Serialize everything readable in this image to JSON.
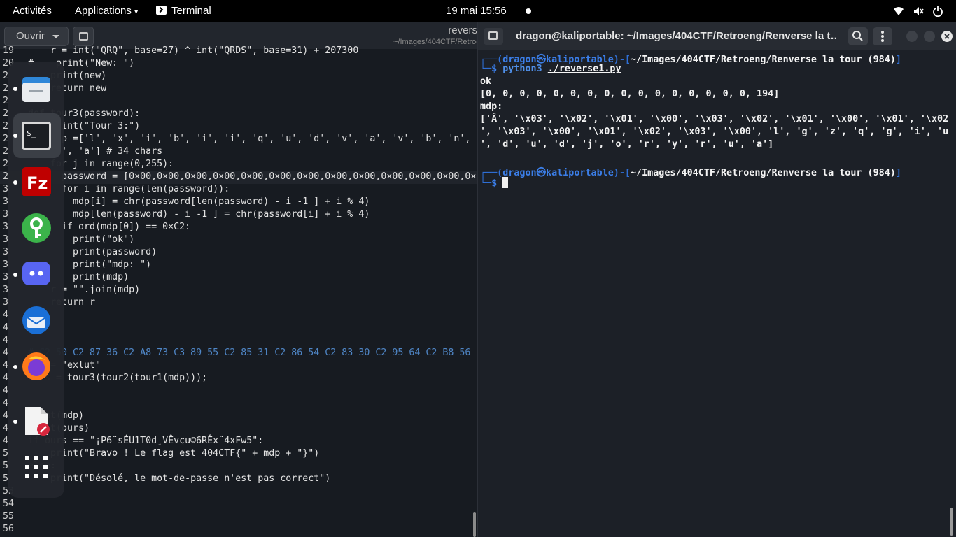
{
  "topbar": {
    "activities": "Activités",
    "applications": "Applications",
    "app_name": "Terminal",
    "clock": "19 mai  15:56"
  },
  "editor": {
    "open_label": "Ouvrir",
    "title": "revers",
    "subtitle": "~/Images/404CTF/Retroe",
    "lines": [
      {
        "n": "19",
        "c": "    r = int(\"QRQ\", base=27) ^ int(\"QRDS\", base=31) + 207300",
        "hl": false
      },
      {
        "n": "20",
        "c": "#    print(\"New: \")",
        "hl": false
      },
      {
        "n": "2",
        "c": "    print(new)",
        "hl": false
      },
      {
        "n": "2",
        "c": "    return new",
        "hl": false
      },
      {
        "n": "2",
        "c": "",
        "hl": false
      },
      {
        "n": "2",
        "c": "def tour3(password):",
        "hl": false
      },
      {
        "n": "2",
        "c": "    print(\"Tour 3:\")",
        "hl": false
      },
      {
        "n": "2",
        "c": "    mdp =['l', 'x', 'i', 'b', 'i', 'i', 'q', 'u', 'd', 'v', 'a', 'v', 'b', 'n', 'l",
        "hl": false
      },
      {
        "n": "2",
        "c": "    'u', 'a'] # 34 chars",
        "hl": false
      },
      {
        "n": "2",
        "c": "    for j in range(0,255):",
        "hl": false
      },
      {
        "n": "2",
        "c": "      password = [0×00,0×00,0×00,0×00,0×00,0×00,0×00,0×00,0×00,0×00,0×00,0×00,0×",
        "hl": true
      },
      {
        "n": "3",
        "c": "      for i in range(len(password)):",
        "hl": false
      },
      {
        "n": "3",
        "c": "        mdp[i] = chr(password[len(password) - i -1 ] + i % 4)",
        "hl": false
      },
      {
        "n": "3",
        "c": "        mdp[len(password) - i -1 ] = chr(password[i] + i % 4)",
        "hl": false
      },
      {
        "n": "3",
        "c": "      if ord(mdp[0]) == 0×C2:",
        "hl": false
      },
      {
        "n": "3",
        "c": "        print(\"ok\")",
        "hl": false
      },
      {
        "n": "3",
        "c": "        print(password)",
        "hl": false
      },
      {
        "n": "3",
        "c": "        print(\"mdp: \")",
        "hl": false
      },
      {
        "n": "3",
        "c": "        print(mdp)",
        "hl": false
      },
      {
        "n": "3",
        "c": "    r = \"\".join(mdp)",
        "hl": false
      },
      {
        "n": "3",
        "c": "    return r",
        "hl": false
      },
      {
        "n": "4",
        "c": "",
        "hl": false
      },
      {
        "n": "4",
        "c": "",
        "hl": false
      },
      {
        "n": "4",
        "c": "",
        "hl": false
      },
      {
        "n": "4",
        "c": "# C2 50 C2 87 36 C2 A8 73 C3 89 55 C2 85 31 C2 86 54 C2 83 30 C2 95 64 C2 B8 56",
        "hl": false,
        "hex": true
      },
      {
        "n": "4",
        "c": "mdp = \"exlut\"",
        "hl": false
      },
      {
        "n": "4",
        "c": "ours = tour3(tour2(tour1(mdp)));",
        "hl": false
      },
      {
        "n": "4",
        "c": "",
        "hl": false
      },
      {
        "n": "4",
        "c": "",
        "hl": false
      },
      {
        "n": "4",
        "c": "print(mdp)",
        "hl": false
      },
      {
        "n": "4",
        "c": "print(ours)",
        "hl": false
      },
      {
        "n": "4",
        "c": "if ours == \"¡P6¨sÉU1T0d¸VÊvçu©6RÊx¨4xFw5\":",
        "hl": false
      },
      {
        "n": "5",
        "c": "    print(\"Bravo ! Le flag est 404CTF{\" + mdp + \"}\")",
        "hl": false
      },
      {
        "n": "5",
        "c": "else:",
        "hl": false
      },
      {
        "n": "5",
        "c": "    print(\"Désolé, le mot-de-passe n'est pas correct\")",
        "hl": false
      },
      {
        "n": "53",
        "c": "",
        "hl": false
      },
      {
        "n": "54",
        "c": "",
        "hl": false
      },
      {
        "n": "55",
        "c": "",
        "hl": false
      },
      {
        "n": "56",
        "c": "",
        "hl": false
      }
    ]
  },
  "dock": {
    "items": [
      "files-icon",
      "terminal-icon",
      "filezilla-icon",
      "keepass-icon",
      "discord-icon",
      "thunderbird-icon",
      "firefox-icon",
      "text-editor-icon",
      "app-grid-icon"
    ]
  },
  "terminal": {
    "title": "dragon@kaliportable: ~/Images/404CTF/Retroeng/Renverse la t…",
    "prompt1": {
      "user": "dragon",
      "host": "kaliportable",
      "path": "~/Images/404CTF/Retroeng/Renverse la tour (984)"
    },
    "command": {
      "cmd": "python3",
      "arg": "./reverse1.py"
    },
    "output": [
      "ok",
      "[0, 0, 0, 0, 0, 0, 0, 0, 0, 0, 0, 0, 0, 0, 0, 0, 194]",
      "mdp:",
      "['Â', '\\x03', '\\x02', '\\x01', '\\x00', '\\x03', '\\x02', '\\x01', '\\x00', '\\x01', '\\x02",
      "', '\\x03', '\\x00', '\\x01', '\\x02', '\\x03', '\\x00', 'l', 'g', 'z', 'q', 'g', 'i', 'u",
      "', 'd', 'u', 'd', 'j', 'o', 'r', 'y', 'r', 'u', 'a']"
    ],
    "prompt2": {
      "user": "dragon",
      "host": "kaliportable",
      "path": "~/Images/404CTF/Retroeng/Renverse la tour (984)"
    }
  }
}
